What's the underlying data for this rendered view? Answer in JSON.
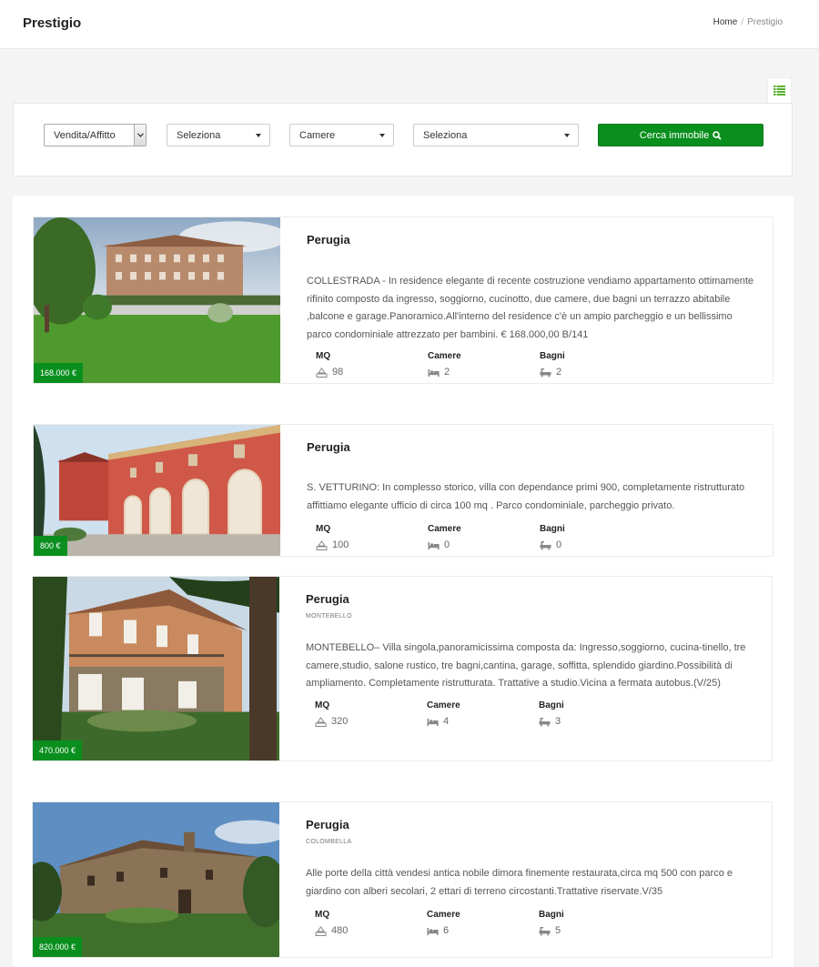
{
  "header": {
    "brand": "Prestigio",
    "breadcrumb": {
      "home": "Home",
      "separator": "/",
      "current": "Prestigio"
    }
  },
  "search": {
    "type_select": "Vendita/Affitto",
    "select_2": "Seleziona",
    "rooms_select": "Camere",
    "select_4": "Seleziona",
    "button_label": "Cerca immobile"
  },
  "stat_labels": {
    "mq": "MQ",
    "rooms": "Camere",
    "baths": "Bagni"
  },
  "listings": [
    {
      "city": "Perugia",
      "area": "",
      "price": "168.000 €",
      "description": "COLLESTRADA - In residence elegante di recente costruzione vendiamo appartamento ottimamente rifinito composto da ingresso, soggiorno, cucinotto, due camere, due bagni un terrazzo abitabile ,balcone e garage.Panoramico.All'interno del residence c'è un ampio parcheggio e un bellissimo parco condominiale attrezzato per bambini. € 168.000,00 B/141",
      "mq": "98",
      "rooms": "2",
      "baths": "2"
    },
    {
      "city": "Perugia",
      "area": "",
      "price": "800 €",
      "description": "S. VETTURINO: In complesso storico, villa con dependance primi 900, completamente ristrutturato affittiamo elegante ufficio di circa 100 mq . Parco condominiale, parcheggio privato.",
      "mq": "100",
      "rooms": "0",
      "baths": "0"
    },
    {
      "city": "Perugia",
      "area": "MONTEBELLO",
      "price": "470.000 €",
      "description": "MONTEBELLO– Villa singola,panoramicissima composta da: Ingresso,soggiorno, cucina-tinello, tre camere,studio, salone rustico, tre bagni,cantina, garage, soffitta, splendido giardino.Possibilità di ampliamento. Completamente ristrutturata. Trattative a studio.Vicina a fermata autobus.(V/25)",
      "mq": "320",
      "rooms": "4",
      "baths": "3"
    },
    {
      "city": "Perugia",
      "area": "COLOMBELLA",
      "price": "820.000 €",
      "description": "Alle porte della città vendesi antica nobile dimora finemente restaurata,circa mq 500 con parco e giardino con alberi secolari, 2 ettari di terreno circostanti.Trattative riservate.V/35",
      "mq": "480",
      "rooms": "6",
      "baths": "5"
    }
  ]
}
